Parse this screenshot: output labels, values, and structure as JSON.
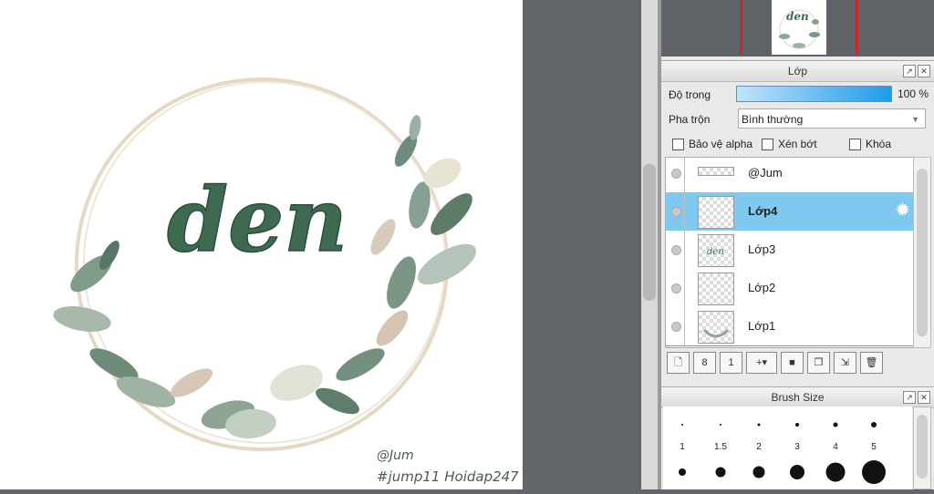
{
  "canvas": {
    "artwork_text": "den",
    "signature_line1": "@Jum",
    "signature_line2": "#jump11 Hoidap247"
  },
  "layer_panel": {
    "title": "Lớp",
    "opacity_label": "Độ trong",
    "opacity_value": "100 %",
    "blend_label": "Pha trộn",
    "blend_value": "Bình thường",
    "checkboxes": [
      "Bảo vệ alpha",
      "Xén bớt",
      "Khóa"
    ],
    "layers": [
      {
        "name": "@Jum",
        "selected": false
      },
      {
        "name": "Lớp4",
        "selected": true
      },
      {
        "name": "Lớp3",
        "selected": false
      },
      {
        "name": "Lớp2",
        "selected": false
      },
      {
        "name": "Lớp1",
        "selected": false
      }
    ],
    "toolbar_icons": [
      "new-layer-icon",
      "new-8bit-layer-icon",
      "new-1bit-layer-icon",
      "add-layer-menu-icon",
      "new-folder-icon",
      "duplicate-layer-icon",
      "merge-down-icon",
      "delete-layer-icon"
    ]
  },
  "brush_panel": {
    "title": "Brush Size",
    "sizes": [
      "1",
      "1.5",
      "2",
      "3",
      "4",
      "5"
    ]
  },
  "colors": {
    "selected_layer": "#7fc8f0",
    "opacity_bar": "#1f9be9",
    "workspace": "#62666b",
    "navigator_frame": "#c72a2a",
    "lettering": "#3f6a52"
  }
}
